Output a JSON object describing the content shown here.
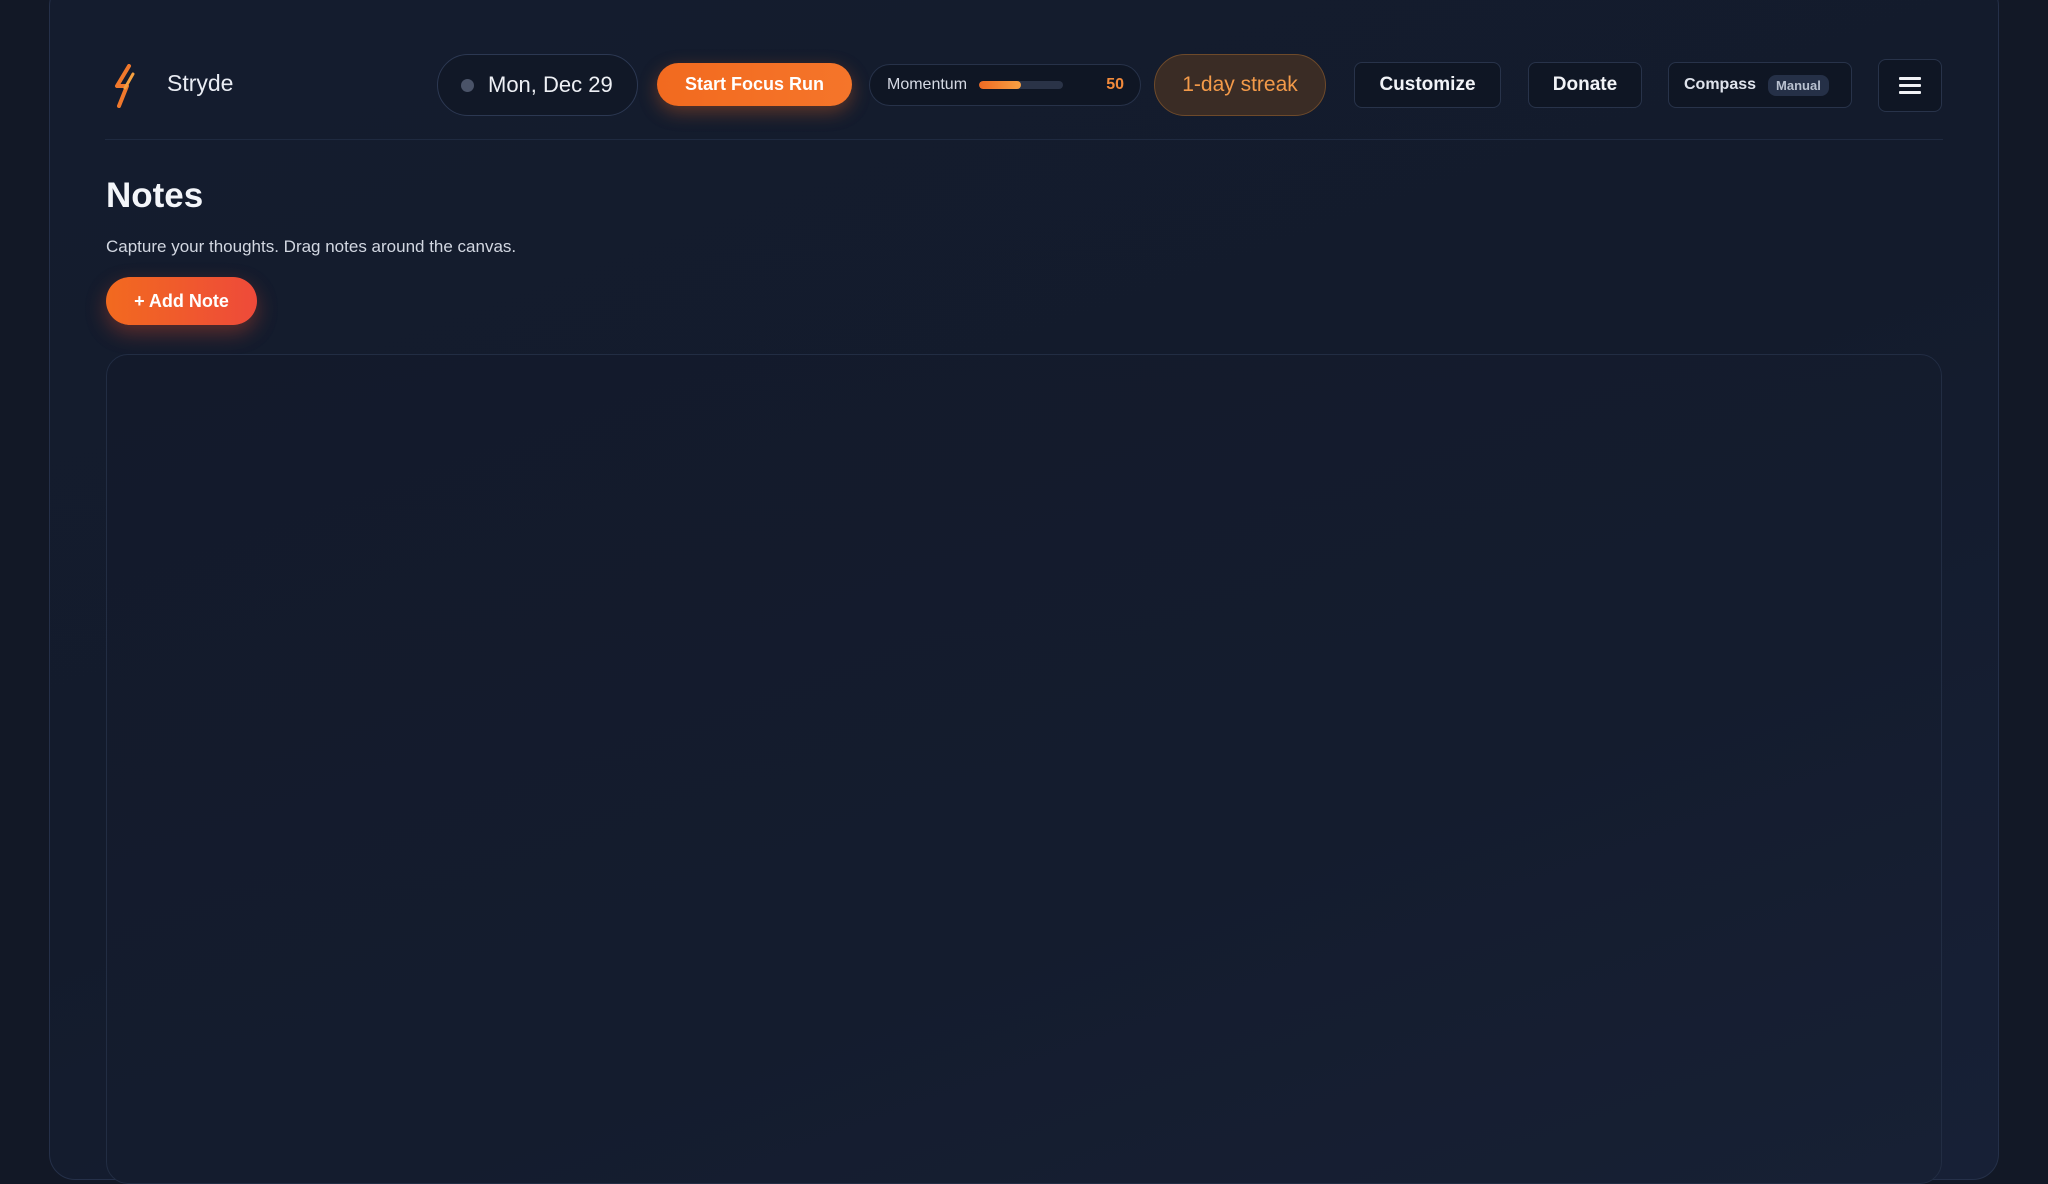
{
  "header": {
    "brand": "Stryde",
    "date": "Mon, Dec 29",
    "focus_button": "Start Focus Run",
    "momentum": {
      "label": "Momentum",
      "value": "50",
      "fill_percent": 50
    },
    "streak": "1-day streak",
    "customize": "Customize",
    "donate": "Donate",
    "compass": {
      "label": "Compass",
      "badge": "Manual"
    },
    "menu_icon": "hamburger-menu-icon",
    "logo_icon": "lightning-bolt-icon"
  },
  "page": {
    "title": "Notes",
    "subtitle": "Capture your thoughts. Drag notes around the canvas.",
    "add_note": "+ Add Note"
  },
  "colors": {
    "accent": "#f26a1f",
    "background": "#121826",
    "streak_text": "#f39a49"
  }
}
